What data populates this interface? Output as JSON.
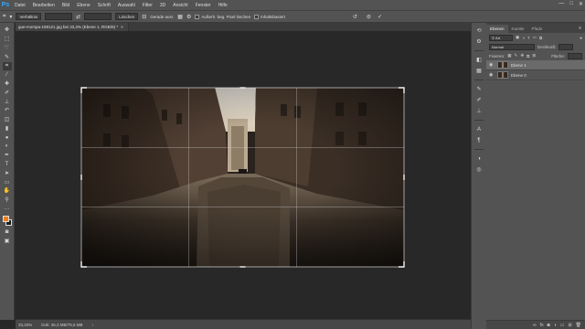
{
  "menubar": {
    "logo": "Ps",
    "items": [
      "Datei",
      "Bearbeiten",
      "Bild",
      "Ebene",
      "Schrift",
      "Auswahl",
      "Filter",
      "3D",
      "Ansicht",
      "Fenster",
      "Hilfe"
    ],
    "win_controls": [
      "—",
      "□",
      "✕"
    ]
  },
  "options": {
    "ratio_select": "Verhältnis",
    "clear_button": "Löschen",
    "straighten_label": "Gerade ausr.",
    "delete_cropped_label": "Außerh. beg. Pixel löschen",
    "content_aware_label": "Inhaltsbasiert"
  },
  "document": {
    "tab_label": "gue-mompa-159121.jpg bei 33,3% (Ebene 1, RGB/8) *",
    "close_glyph": "×"
  },
  "status": {
    "zoom": "33,33%",
    "doc_size": "Dok: 45,3 MB/75,6 MB"
  },
  "layers_panel": {
    "tabs": [
      "Ebenen",
      "Kanäle",
      "Pfade"
    ],
    "filter_select": "Art",
    "blend_mode": "Normal",
    "opacity_label": "Deckkraft:",
    "lock_label": "Fixieren:",
    "fill_label": "Fläche:",
    "layers": [
      {
        "name": "Ebene 1",
        "selected": true
      },
      {
        "name": "Ebene 0",
        "selected": false
      }
    ]
  },
  "colors": {
    "foreground": "#ef7d1a",
    "background": "#1a1a1a",
    "accent": "#31a8ff"
  }
}
